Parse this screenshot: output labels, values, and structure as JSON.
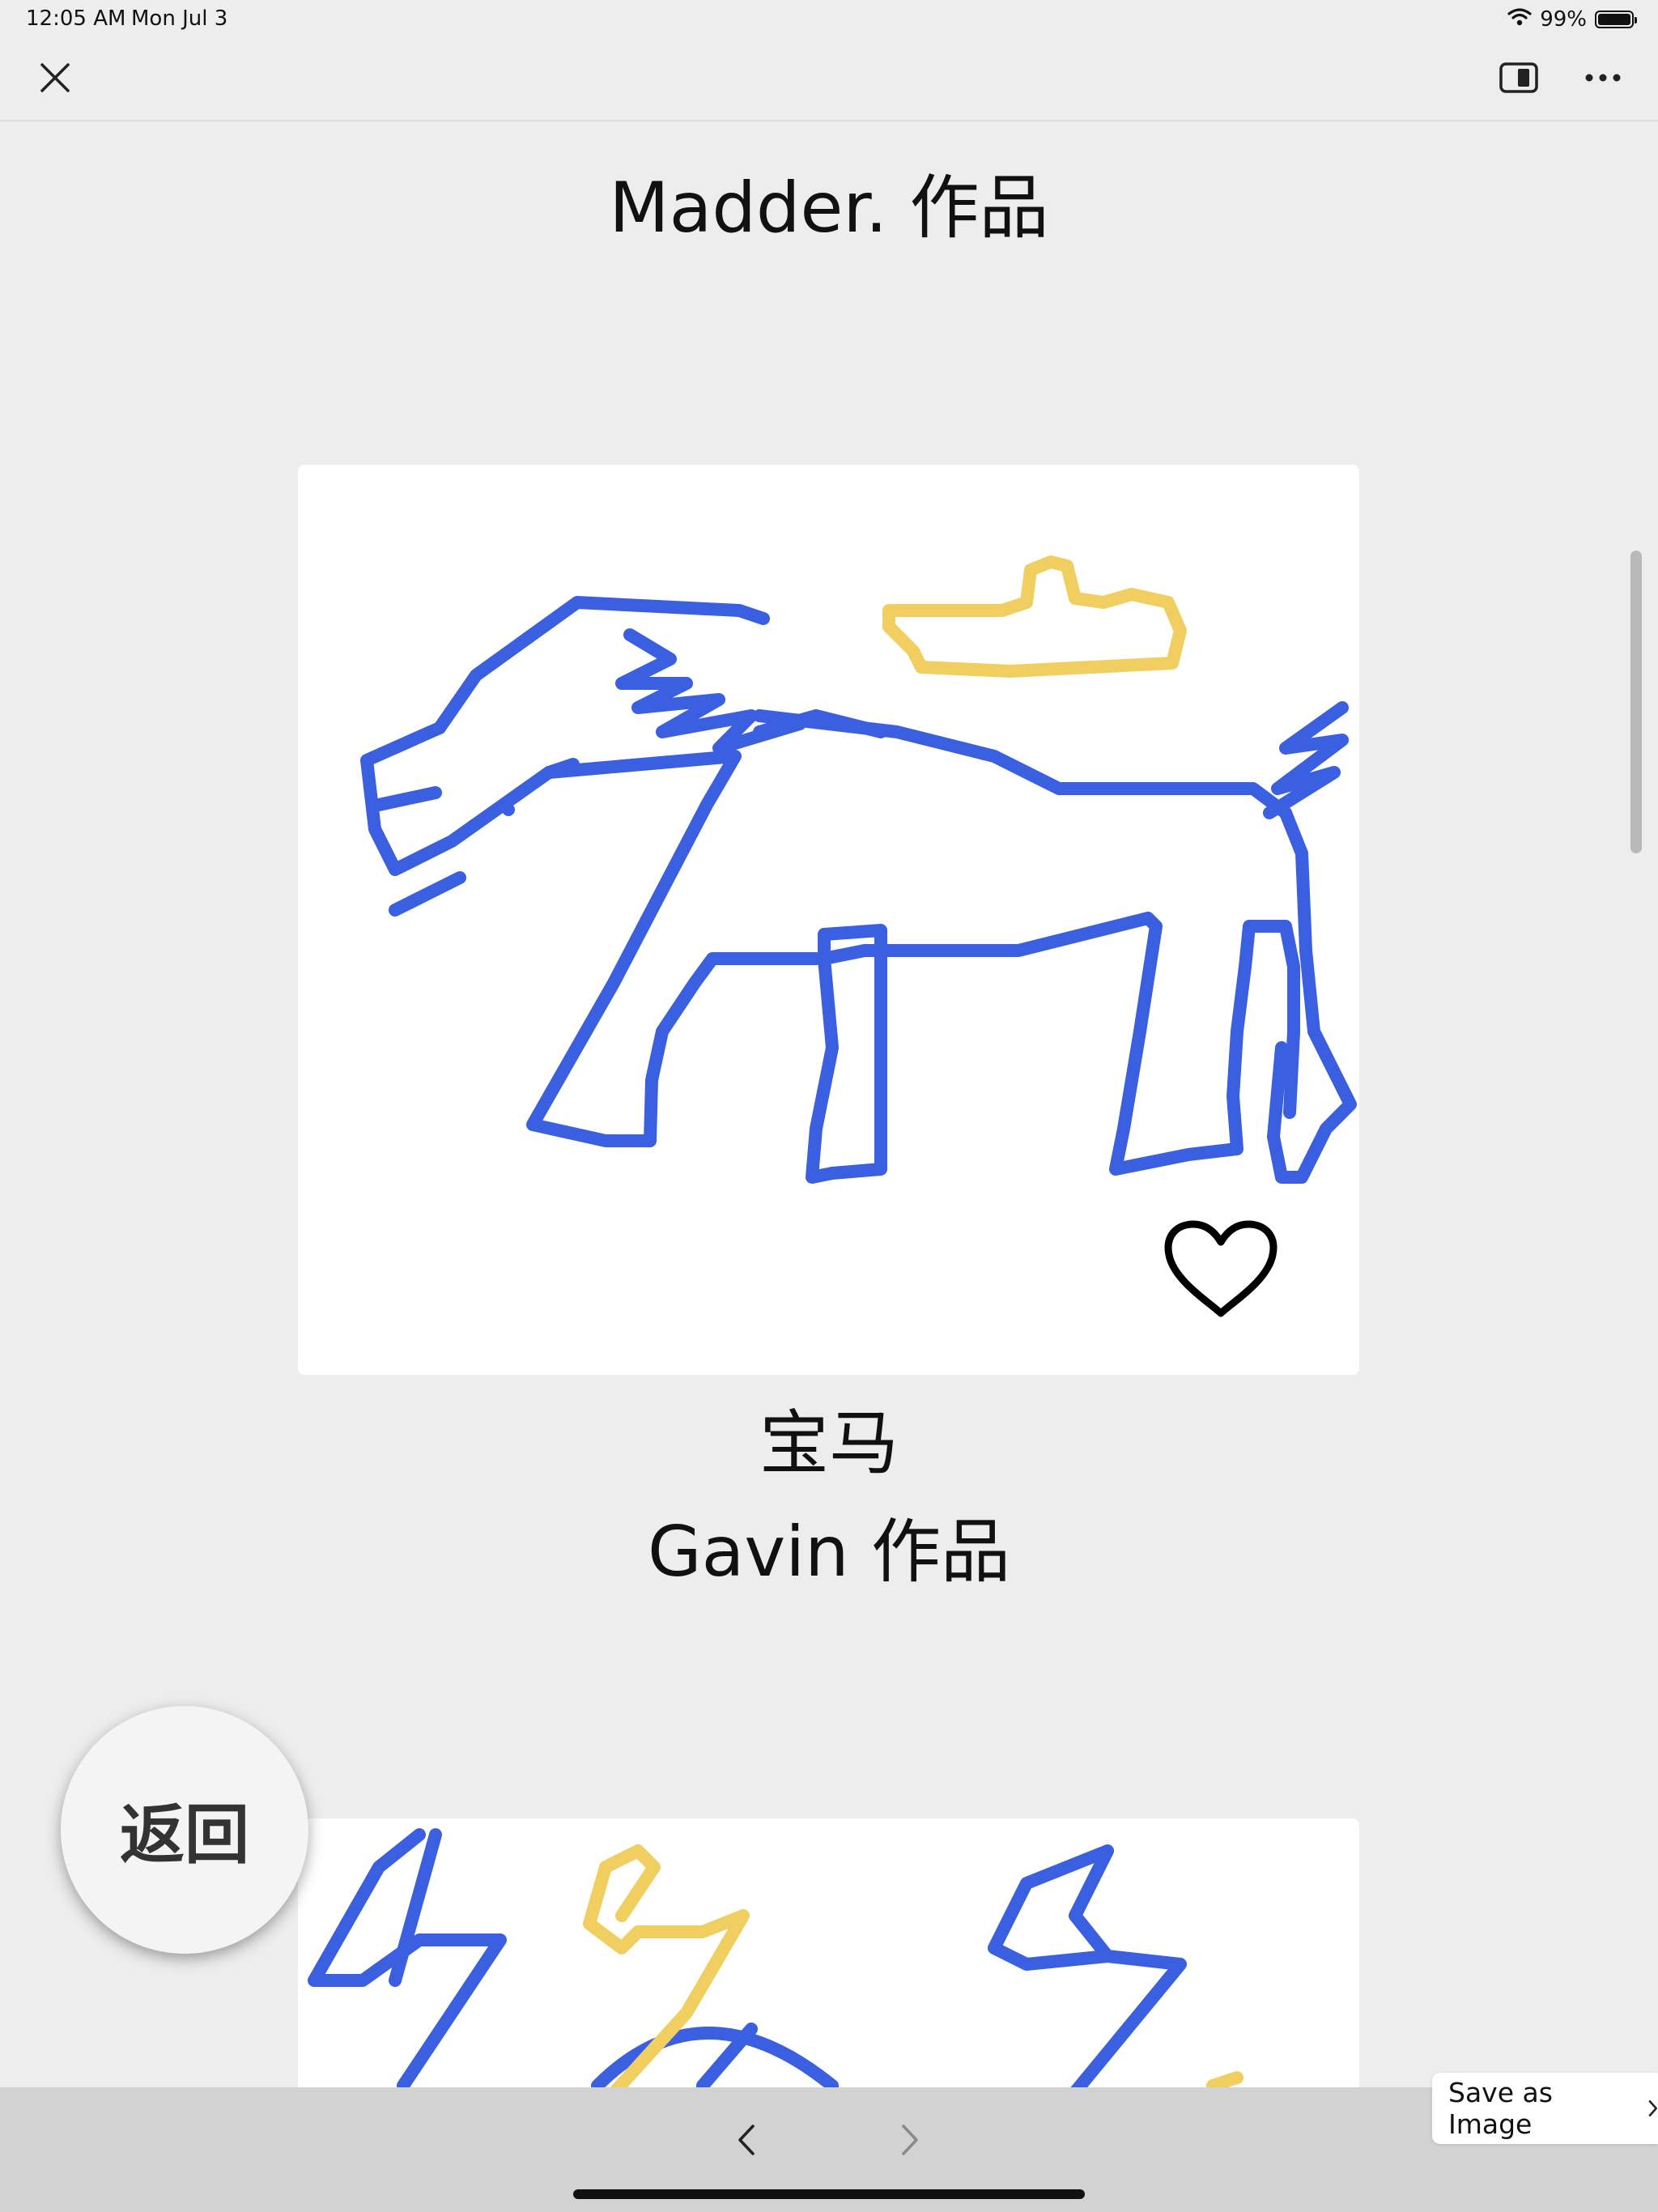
{
  "status_bar": {
    "time": "12:05 AM",
    "date": "Mon Jul 3",
    "battery_text": "99%",
    "battery_level": 0.99,
    "wifi_icon": "wifi-icon",
    "battery_icon": "battery-icon"
  },
  "nav": {
    "close_icon": "close-icon",
    "sidebar_icon": "sidebar-toggle-icon",
    "more_icon": "more-icon"
  },
  "page": {
    "title": "Madder. 作品"
  },
  "artworks": [
    {
      "title": "宝马",
      "author": "Gavin 作品",
      "like_icon": "heart-icon"
    },
    {
      "title": "",
      "author": ""
    }
  ],
  "floating": {
    "back_label": "返回"
  },
  "toolbar": {
    "back_icon": "chevron-left-icon",
    "forward_icon": "chevron-right-icon",
    "save_label": "Save as Image",
    "save_icon": "chevron-right-icon"
  },
  "colors": {
    "stroke_blue": "#3a5fe0",
    "stroke_yellow": "#f0cf60",
    "background": "#ededed",
    "toolbar": "#d2d2d2"
  }
}
